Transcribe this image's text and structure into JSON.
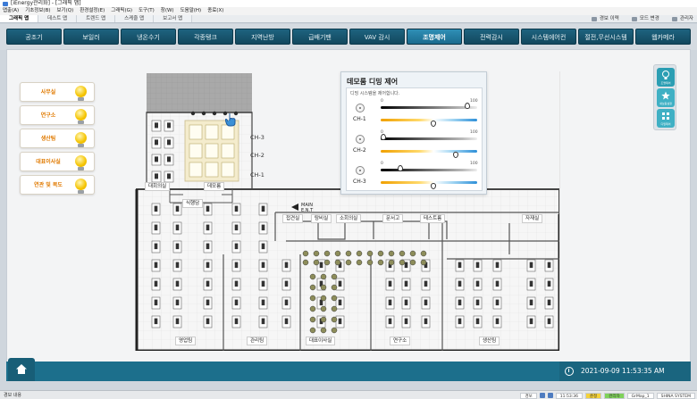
{
  "window": {
    "title": "[iEnergy관리화] - [그래픽 맵]"
  },
  "menubar": [
    "맵출(A)",
    "기초정보(B)",
    "보기(Q)",
    "환경설정(E)",
    "그래픽(G)",
    "도구(T)",
    "창(W)",
    "도움말(H)",
    "종료(X)"
  ],
  "tabs": [
    {
      "label": "그래픽 맵",
      "active": true
    },
    {
      "label": "데스트 맵",
      "active": false
    },
    {
      "label": "트렌드 맵",
      "active": false
    },
    {
      "label": "스케줄 맵",
      "active": false
    },
    {
      "label": "보고서 맵",
      "active": false
    }
  ],
  "tabright": {
    "alarm": "경보 이력",
    "mode": "모드 변경",
    "admin": "관리자"
  },
  "nav": [
    {
      "label": "공조기",
      "active": false
    },
    {
      "label": "보일러",
      "active": false
    },
    {
      "label": "냉온수기",
      "active": false
    },
    {
      "label": "각종탱크",
      "active": false
    },
    {
      "label": "지역난방",
      "active": false
    },
    {
      "label": "급배기팬",
      "active": false
    },
    {
      "label": "VAV 감시",
      "active": false
    },
    {
      "label": "조명제어",
      "active": true
    },
    {
      "label": "전력감시",
      "active": false
    },
    {
      "label": "시스템에어컨",
      "active": false
    },
    {
      "label": "절전,무선시스템",
      "active": false
    },
    {
      "label": "웹카메라",
      "active": false
    }
  ],
  "rooms": [
    {
      "label": "사무실",
      "icon": "light-bulb-icon"
    },
    {
      "label": "연구소",
      "icon": "light-bulb-icon"
    },
    {
      "label": "생산팀",
      "icon": "light-bulb-icon"
    },
    {
      "label": "대표이사실",
      "icon": "light-bulb-icon"
    },
    {
      "label": "연관 및 복도",
      "icon": "light-bulb-icon"
    }
  ],
  "floorplan": {
    "channels": [
      "CH-3",
      "CH-2",
      "CH-1"
    ],
    "room_labels": {
      "meeting": "대회의실",
      "demo": "데모룸",
      "dining": "식행담",
      "jeonjeon": "접견실",
      "tangbi": "탕비실",
      "small_meeting": "소회의실",
      "archive": "문서고",
      "testroom": "테스트룸",
      "materials": "자재실",
      "sales": "영업팀",
      "management": "관리팀",
      "ceo": "대표이사실",
      "research": "연구소",
      "production": "생산팀"
    },
    "main_entrance": [
      "MAIN",
      "E.N.T"
    ]
  },
  "dimming": {
    "title": "데모룸 디밍 제어",
    "subtitle": "디밍 시스템을 제어합니다.",
    "scale_min": "0",
    "scale_max": "100",
    "channels": [
      {
        "name": "CH-1",
        "level": 90,
        "color_temp": 55
      },
      {
        "name": "CH-2",
        "level": 3,
        "color_temp": 78
      },
      {
        "name": "CH-3",
        "level": 20,
        "color_temp": 55
      }
    ]
  },
  "sidepanel": [
    {
      "label": "조명제어",
      "icon": "bulb-icon"
    },
    {
      "label": "새보등설정",
      "icon": "star-icon"
    },
    {
      "label": "디밍제어",
      "icon": "grid-icon"
    }
  ],
  "clock": {
    "datetime": "2021-09-09 11:53:35 AM"
  },
  "statusbar": {
    "left": "경보 내용",
    "items": [
      "경보",
      "11:53:36",
      "준정",
      "관리자",
      "GrMap_1",
      "SHINA SYSTEM"
    ]
  },
  "colors": {
    "nav": "#12485e",
    "nav_active": "#1b6b8e",
    "bottom": "#1c6f8c",
    "room_label": "#e07a00",
    "bulb": "#f5c400"
  }
}
